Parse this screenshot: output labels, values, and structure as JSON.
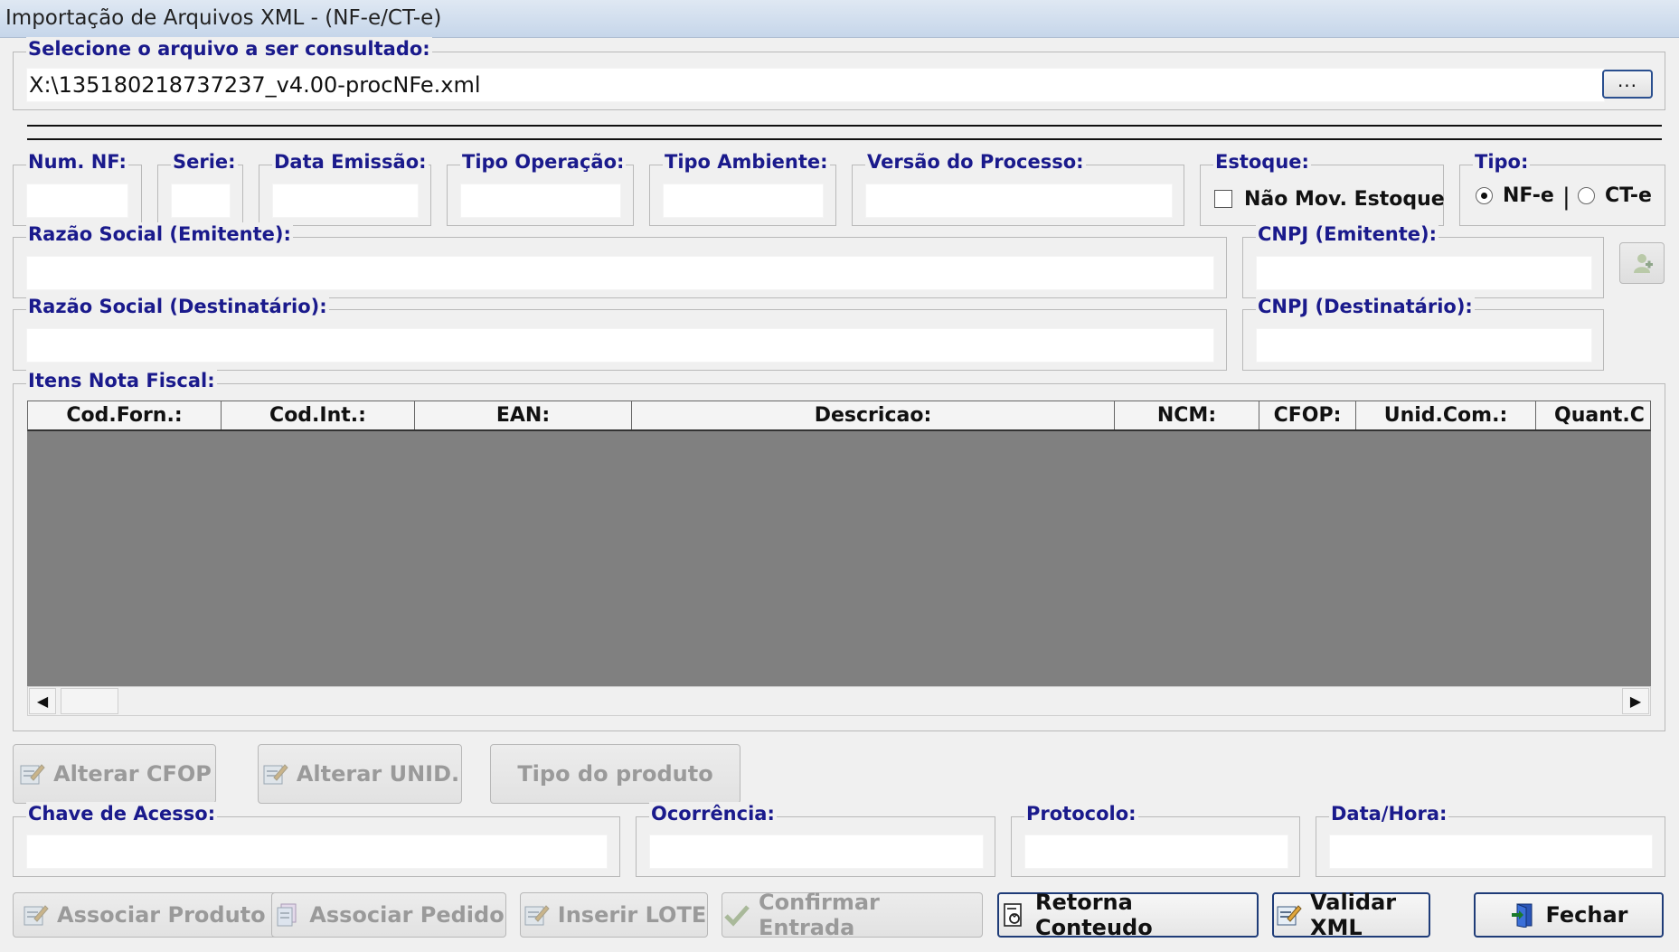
{
  "window": {
    "title": "Importação de Arquivos XML - (NF-e/CT-e)"
  },
  "file_select": {
    "label": "Selecione o arquivo a ser consultado:",
    "value": "X:\\135180218737237_v4.00-procNFe.xml",
    "browse_label": "..."
  },
  "header_fields": {
    "num_nf": {
      "label": "Num. NF:",
      "value": ""
    },
    "serie": {
      "label": "Serie:",
      "value": ""
    },
    "data_emissao": {
      "label": "Data Emissão:",
      "value": ""
    },
    "tipo_operacao": {
      "label": "Tipo Operação:",
      "value": ""
    },
    "tipo_ambiente": {
      "label": "Tipo Ambiente:",
      "value": ""
    },
    "versao_processo": {
      "label": "Versão do Processo:",
      "value": ""
    },
    "estoque": {
      "label": "Estoque:",
      "checkbox_label": "Não Mov. Estoque",
      "checked": false
    },
    "tipo": {
      "label": "Tipo:",
      "options": [
        "NF-e",
        "CT-e"
      ],
      "selected": "NF-e",
      "separator": "|"
    }
  },
  "emitente": {
    "razao_label": "Razão Social (Emitente):",
    "razao_value": "",
    "cnpj_label": "CNPJ (Emitente):",
    "cnpj_value": ""
  },
  "destinatario": {
    "razao_label": "Razão Social (Destinatário):",
    "razao_value": "",
    "cnpj_label": "CNPJ (Destinatário):",
    "cnpj_value": ""
  },
  "items": {
    "label": "Itens Nota Fiscal:",
    "columns": [
      "Cod.Forn.:",
      "Cod.Int.:",
      "EAN:",
      "Descricao:",
      "NCM:",
      "CFOP:",
      "Unid.Com.:",
      "Quant.C"
    ],
    "rows": []
  },
  "mid_buttons": {
    "alterar_cfop": "Alterar CFOP",
    "alterar_unid": "Alterar UNID.",
    "tipo_produto": "Tipo do produto"
  },
  "footer_fields": {
    "chave": {
      "label": "Chave de Acesso:",
      "value": ""
    },
    "ocorrencia": {
      "label": "Ocorrência:",
      "value": ""
    },
    "protocolo": {
      "label": "Protocolo:",
      "value": ""
    },
    "data_hora": {
      "label": "Data/Hora:",
      "value": ""
    }
  },
  "bottom_buttons": {
    "associar_produto": "Associar Produto",
    "associar_pedido": "Associar Pedido",
    "inserir_lote": "Inserir LOTE",
    "confirmar_entrada": "Confirmar Entrada",
    "retorna_conteudo": "Retorna Conteudo",
    "validar_xml": "Validar XML",
    "fechar": "Fechar"
  },
  "colors": {
    "label_blue": "#1a1a8c",
    "grid_bg": "#808080",
    "active_border": "#1f3c78"
  }
}
